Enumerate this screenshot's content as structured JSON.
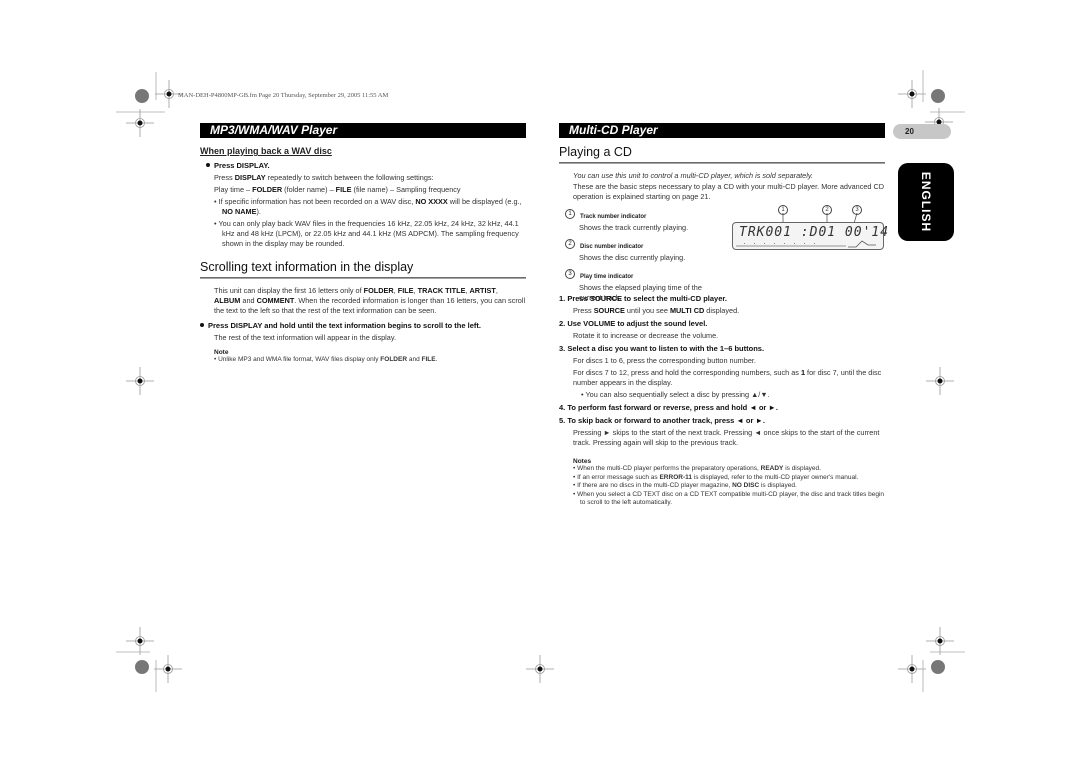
{
  "header": {
    "file_line": "MAN-DEH-P4800MP-GB.fm  Page 20  Thursday, September 29, 2005  11:55 AM"
  },
  "left": {
    "section_title": "MP3/WMA/WAV Player",
    "wav": {
      "heading": "When playing back a WAV disc",
      "step": "Press DISPLAY.",
      "desc_pre": "Press ",
      "desc_bold": "DISPLAY",
      "desc_post": " repeatedly to switch between the following settings:",
      "cycle": [
        {
          "text": "Play time – ",
          "bold": false
        },
        {
          "text": "FOLDER",
          "bold": true
        },
        {
          "text": " (folder name) – ",
          "bold": false
        },
        {
          "text": "FILE",
          "bold": true
        },
        {
          "text": " (file name) – Sampling frequency",
          "bold": false
        }
      ],
      "bullets": [
        [
          {
            "text": "If specific information has not been recorded on a WAV disc, ",
            "bold": false
          },
          {
            "text": "NO XXXX",
            "bold": true
          },
          {
            "text": " will be displayed (e.g., ",
            "bold": false
          },
          {
            "text": "NO NAME",
            "bold": true
          },
          {
            "text": ").",
            "bold": false
          }
        ],
        [
          {
            "text": "You can only play back WAV files in the frequencies 16 kHz, 22.05 kHz, 24 kHz, 32 kHz, 44.1 kHz and 48 kHz (LPCM), or 22.05 kHz and 44.1 kHz (MS ADPCM). The sampling frequency shown in the display may be rounded.",
            "bold": false
          }
        ]
      ]
    },
    "scroll": {
      "heading": "Scrolling text information in the display",
      "intro": [
        {
          "text": "This unit can display the first 16 letters only of ",
          "bold": false
        },
        {
          "text": "FOLDER",
          "bold": true
        },
        {
          "text": ", ",
          "bold": false
        },
        {
          "text": "FILE",
          "bold": true
        },
        {
          "text": ", ",
          "bold": false
        },
        {
          "text": "TRACK TITLE",
          "bold": true
        },
        {
          "text": ", ",
          "bold": false
        },
        {
          "text": "ARTIST",
          "bold": true
        },
        {
          "text": ", ",
          "bold": false
        },
        {
          "text": "ALBUM",
          "bold": true
        },
        {
          "text": " and ",
          "bold": false
        },
        {
          "text": "COMMENT",
          "bold": true
        },
        {
          "text": ". When the recorded information is longer than 16 letters, you can scroll the text to the left so that the rest of the text information can be seen.",
          "bold": false
        }
      ],
      "step": "Press DISPLAY and hold until the text information begins to scroll to the left.",
      "step_desc": "The rest of the text information will appear in the display.",
      "note_heading": "Note",
      "note": [
        {
          "text": "Unlike MP3 and WMA file format, WAV files display only ",
          "bold": false
        },
        {
          "text": "FOLDER",
          "bold": true
        },
        {
          "text": " and ",
          "bold": false
        },
        {
          "text": "FILE",
          "bold": true
        },
        {
          "text": ".",
          "bold": false
        }
      ]
    }
  },
  "right": {
    "section_title": "Multi-CD Player",
    "heading": "Playing a CD",
    "intro_italic": "You can use this unit to control a multi-CD player, which is sold separately.",
    "intro": "These are the basic steps necessary to play a CD with your multi-CD player. More advanced CD operation is explained starting on page 21.",
    "indicators": [
      {
        "num": "1",
        "label": "Track number indicator",
        "desc": "Shows the track currently playing."
      },
      {
        "num": "2",
        "label": "Disc number indicator",
        "desc": "Shows the disc currently playing."
      },
      {
        "num": "3",
        "label": "Play time indicator",
        "desc": "Shows the elapsed playing time of the current track."
      }
    ],
    "lcd": {
      "text": "TRK001  :D01  00'14",
      "callouts": [
        "1",
        "2",
        "3"
      ]
    },
    "steps": [
      {
        "title": "1. Press SOURCE to select the multi-CD player.",
        "desc": [
          {
            "text": "Press ",
            "bold": false
          },
          {
            "text": "SOURCE",
            "bold": true
          },
          {
            "text": " until you see ",
            "bold": false
          },
          {
            "text": "MULTI CD",
            "bold": true
          },
          {
            "text": " displayed.",
            "bold": false
          }
        ]
      },
      {
        "title": "2. Use VOLUME to adjust the sound level.",
        "desc": [
          {
            "text": "Rotate it to increase or decrease the volume.",
            "bold": false
          }
        ]
      },
      {
        "title": "3. Select a disc you want to listen to with the 1–6 buttons.",
        "desc": [
          {
            "text": "For discs 1 to 6, press the corresponding button number.",
            "bold": false
          }
        ],
        "desc2": [
          {
            "text": "For discs 7 to 12, press and hold the corresponding numbers, such as ",
            "bold": false
          },
          {
            "text": "1",
            "bold": true
          },
          {
            "text": " for disc 7, until the disc number appears in the display.",
            "bold": false
          }
        ],
        "bullet": "You can also sequentially select a disc by pressing ▲/▼."
      },
      {
        "title": "4. To perform fast forward or reverse, press and hold ◄ or ►."
      },
      {
        "title": "5. To skip back or forward to another track, press ◄ or ►.",
        "desc": [
          {
            "text": "Pressing ► skips to the start of the next track. Pressing ◄ once skips to the start of the current track. Pressing again will skip to the previous track.",
            "bold": false
          }
        ]
      }
    ],
    "notes_heading": "Notes",
    "notes": [
      [
        {
          "text": "When the multi-CD player performs the preparatory operations, ",
          "bold": false
        },
        {
          "text": "READY",
          "bold": true
        },
        {
          "text": " is displayed.",
          "bold": false
        }
      ],
      [
        {
          "text": "If an error message such as ",
          "bold": false
        },
        {
          "text": "ERROR-11",
          "bold": true
        },
        {
          "text": " is displayed, refer to the multi-CD player owner's manual.",
          "bold": false
        }
      ],
      [
        {
          "text": "If there are no discs in the multi-CD player magazine, ",
          "bold": false
        },
        {
          "text": "NO DISC",
          "bold": true
        },
        {
          "text": " is displayed.",
          "bold": false
        }
      ],
      [
        {
          "text": "When you select a CD TEXT disc on a CD TEXT compatible multi-CD player, the disc and track titles begin to scroll to the left automatically.",
          "bold": false
        }
      ]
    ]
  },
  "page_tab": {
    "number": "20"
  },
  "language_tab": {
    "label": "ENGLISH"
  }
}
